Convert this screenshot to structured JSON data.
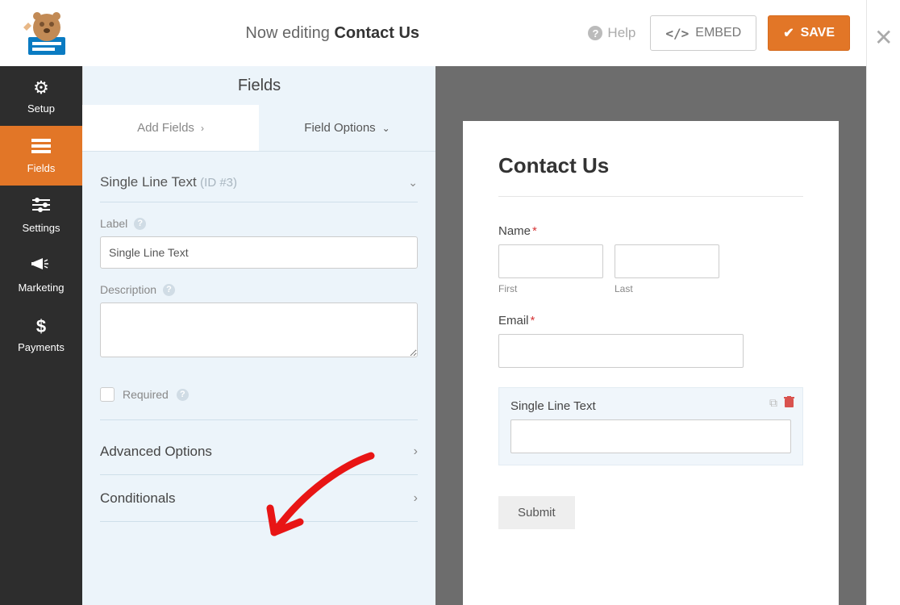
{
  "header": {
    "editing_prefix": "Now editing",
    "editing_title": "Contact Us",
    "help": "Help",
    "embed": "EMBED",
    "save": "SAVE"
  },
  "sidebar": {
    "items": [
      {
        "label": "Setup"
      },
      {
        "label": "Fields"
      },
      {
        "label": "Settings"
      },
      {
        "label": "Marketing"
      },
      {
        "label": "Payments"
      }
    ]
  },
  "panel": {
    "header": "Fields",
    "tabs": {
      "add": "Add Fields",
      "options": "Field Options"
    },
    "field": {
      "name": "Single Line Text",
      "id_label": "(ID #3)"
    },
    "label_label": "Label",
    "label_value": "Single Line Text",
    "description_label": "Description",
    "description_value": "",
    "required_label": "Required",
    "advanced": "Advanced Options",
    "conditionals": "Conditionals"
  },
  "preview": {
    "title": "Contact Us",
    "name_label": "Name",
    "first": "First",
    "last": "Last",
    "email_label": "Email",
    "single_line": "Single Line Text",
    "submit": "Submit"
  }
}
